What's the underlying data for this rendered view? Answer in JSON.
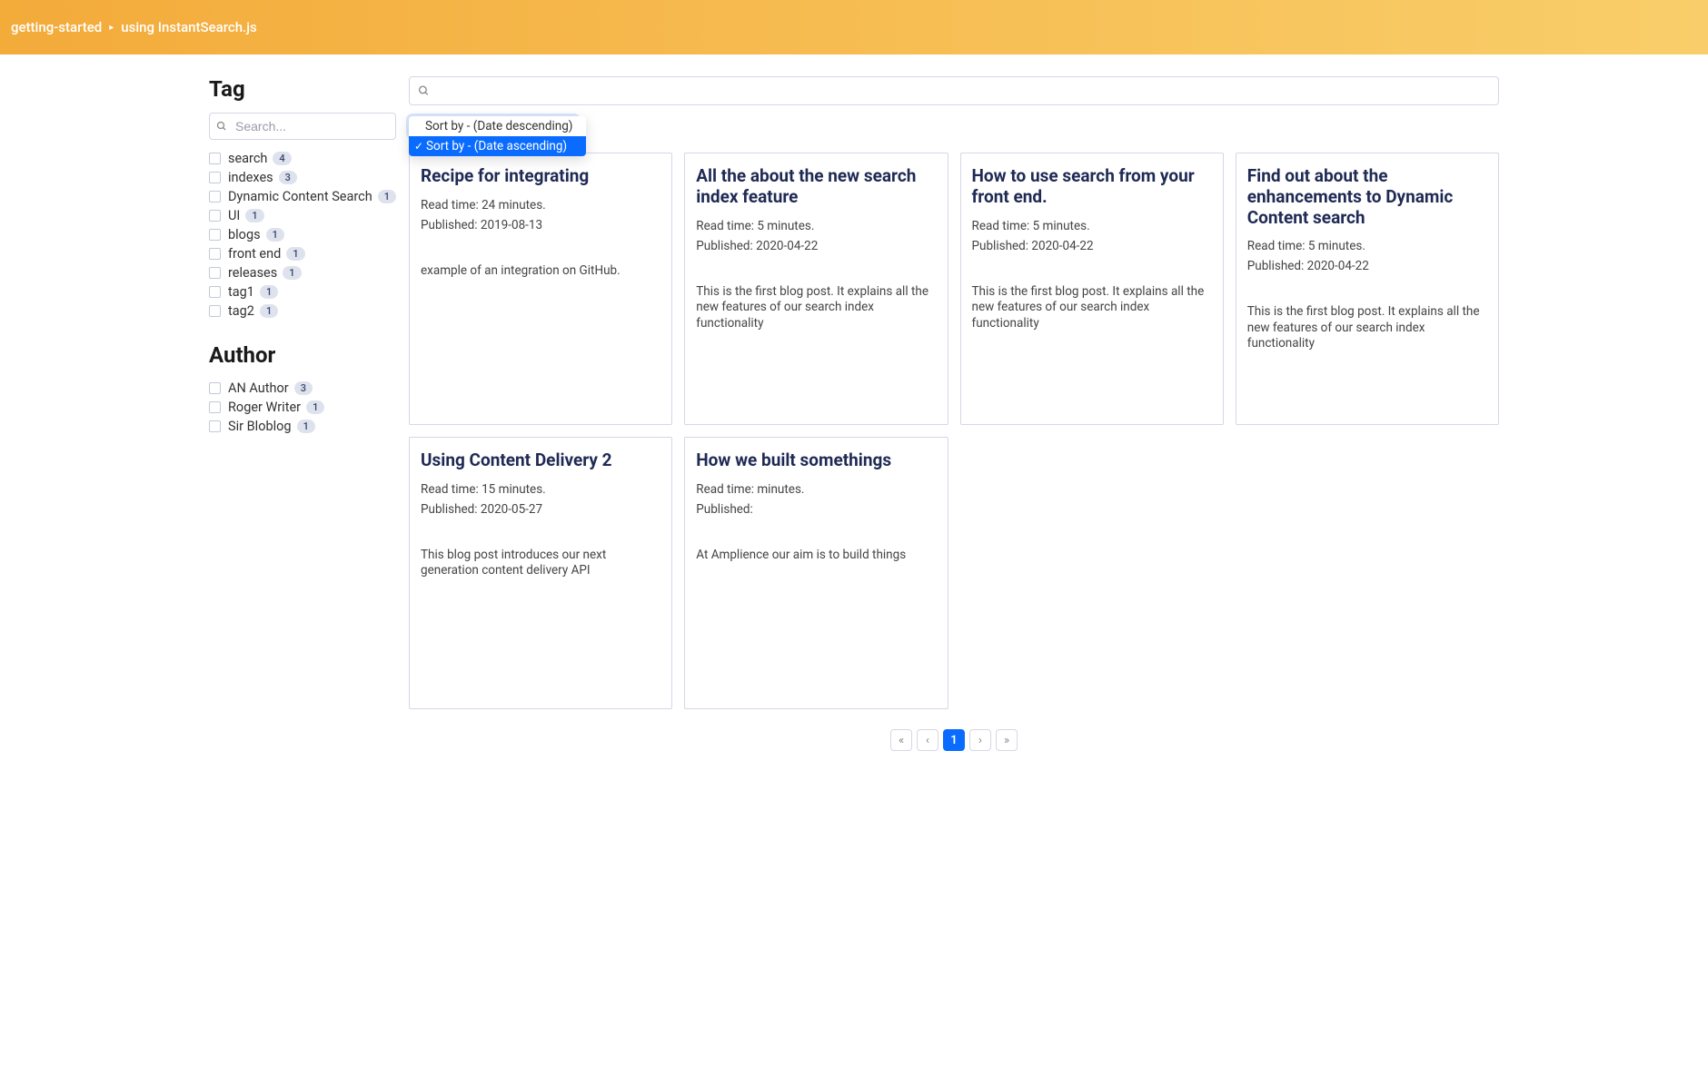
{
  "header": {
    "left": "getting-started",
    "right": "using InstantSearch.js"
  },
  "sidebar": {
    "tag_heading": "Tag",
    "facet_search_placeholder": "Search...",
    "tags": [
      {
        "label": "search",
        "count": "4"
      },
      {
        "label": "indexes",
        "count": "3"
      },
      {
        "label": "Dynamic Content Search",
        "count": "1"
      },
      {
        "label": "UI",
        "count": "1"
      },
      {
        "label": "blogs",
        "count": "1"
      },
      {
        "label": "front end",
        "count": "1"
      },
      {
        "label": "releases",
        "count": "1"
      },
      {
        "label": "tag1",
        "count": "1"
      },
      {
        "label": "tag2",
        "count": "1"
      }
    ],
    "author_heading": "Author",
    "authors": [
      {
        "label": "AN Author",
        "count": "3"
      },
      {
        "label": "Roger Writer",
        "count": "1"
      },
      {
        "label": "Sir Bloblog",
        "count": "1"
      }
    ]
  },
  "main": {
    "search_placeholder": "",
    "sort_options": [
      {
        "label": "Sort by - (Date descending)",
        "selected": false
      },
      {
        "label": "Sort by - (Date ascending)",
        "selected": true
      }
    ],
    "hits": [
      {
        "title": "Recipe for integrating",
        "read_time": "Read time: 24 minutes.",
        "published": "Published: 2019-08-13",
        "desc": "example of an integration on GitHub."
      },
      {
        "title": "All the about the new search index feature",
        "read_time": "Read time: 5 minutes.",
        "published": "Published: 2020-04-22",
        "desc": "This is the first blog post. It explains all the new features of our search index functionality"
      },
      {
        "title": "How to use search from your front end.",
        "read_time": "Read time: 5 minutes.",
        "published": "Published: 2020-04-22",
        "desc": "This is the first blog post. It explains all the new features of our search index functionality"
      },
      {
        "title": "Find out about the enhancements to Dynamic Content search",
        "read_time": "Read time: 5 minutes.",
        "published": "Published: 2020-04-22",
        "desc": "This is the first blog post. It explains all the new features of our search index functionality"
      },
      {
        "title": "Using Content Delivery 2",
        "read_time": "Read time: 15 minutes.",
        "published": "Published: 2020-05-27",
        "desc": "This blog post introduces our next generation content delivery API"
      },
      {
        "title": "How we built somethings",
        "read_time": "Read time:  minutes.",
        "published": "Published:",
        "desc": "At Amplience our aim is to build things"
      }
    ],
    "pagination": {
      "first": "«",
      "prev": "‹",
      "pages": [
        "1"
      ],
      "active_page": "1",
      "next": "›",
      "last": "»"
    }
  }
}
